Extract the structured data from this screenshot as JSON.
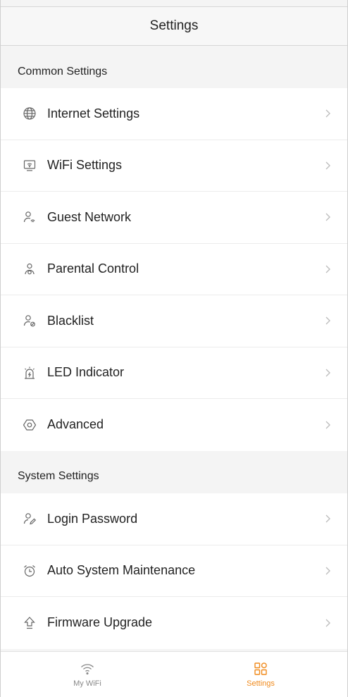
{
  "header": {
    "title": "Settings"
  },
  "sections": [
    {
      "title": "Common Settings",
      "items": [
        {
          "label": "Internet Settings",
          "icon": "globe-icon"
        },
        {
          "label": "WiFi Settings",
          "icon": "router-icon"
        },
        {
          "label": "Guest Network",
          "icon": "guest-user-icon"
        },
        {
          "label": "Parental Control",
          "icon": "parental-user-icon"
        },
        {
          "label": "Blacklist",
          "icon": "blocked-user-icon"
        },
        {
          "label": "LED Indicator",
          "icon": "led-indicator-icon"
        },
        {
          "label": "Advanced",
          "icon": "hexagon-settings-icon"
        }
      ]
    },
    {
      "title": "System Settings",
      "items": [
        {
          "label": "Login Password",
          "icon": "user-edit-icon"
        },
        {
          "label": "Auto System Maintenance",
          "icon": "alarm-clock-icon"
        },
        {
          "label": "Firmware Upgrade",
          "icon": "upgrade-arrow-icon"
        }
      ]
    }
  ],
  "tabbar": {
    "tabs": [
      {
        "label": "My WiFi",
        "icon": "wifi-icon",
        "active": false
      },
      {
        "label": "Settings",
        "icon": "grid-icon",
        "active": true
      }
    ]
  },
  "colors": {
    "accent": "#f08a1c",
    "inactive": "#888888",
    "icon": "#666666",
    "chevron": "#bdbdbd"
  }
}
